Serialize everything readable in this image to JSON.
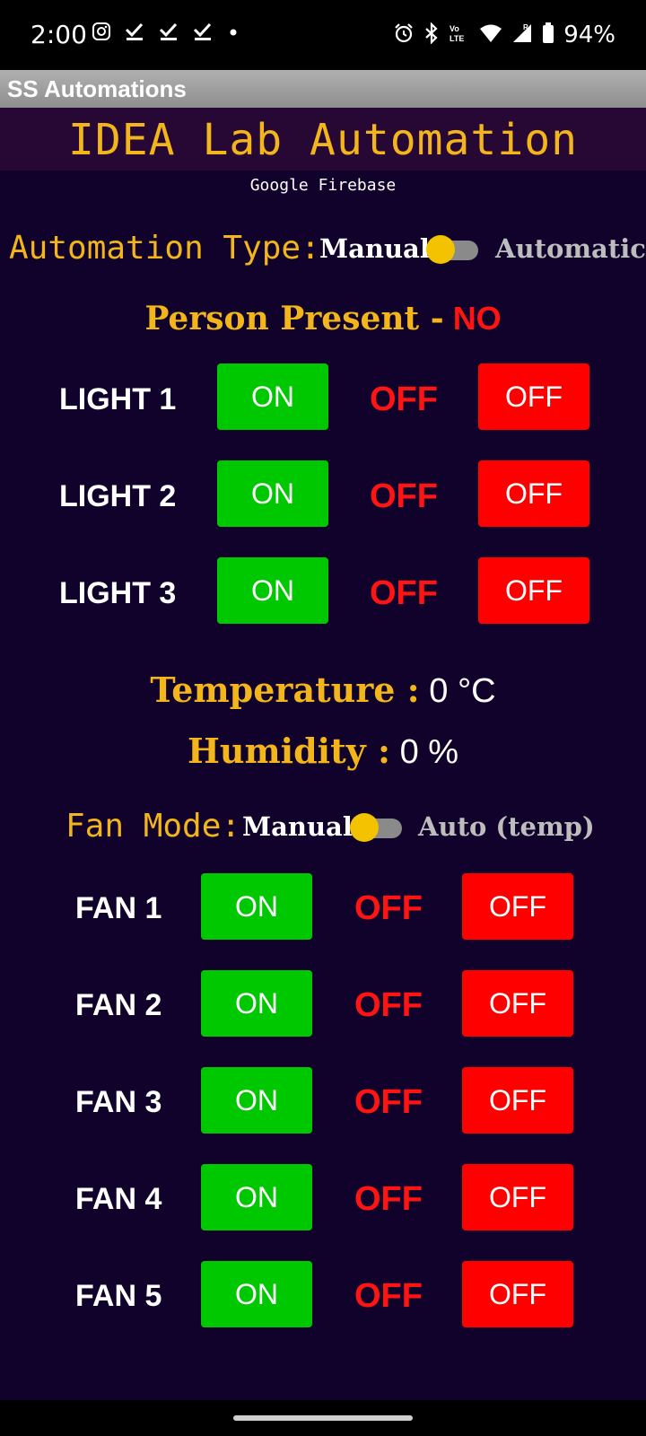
{
  "status_bar": {
    "time": "2:00",
    "left_icons": [
      "instagram-icon",
      "check-icon",
      "check-icon",
      "check-icon",
      "dot-icon"
    ],
    "right_icons": [
      "alarm-icon",
      "bluetooth-icon",
      "volte-icon",
      "wifi-icon",
      "signal-icon",
      "battery-icon"
    ],
    "battery": "94%"
  },
  "app_bar": {
    "title": "SS Automations"
  },
  "header": {
    "title": "IDEA Lab Automation",
    "subtitle": "Google Firebase"
  },
  "automation": {
    "label": "Automation Type:",
    "manual_label": "Manual",
    "auto_label": "Automatic"
  },
  "presence": {
    "label": "Person Present -",
    "value": "NO"
  },
  "lights": [
    {
      "label": "LIGHT 1",
      "on_label": "ON",
      "state": "OFF",
      "off_label": "OFF"
    },
    {
      "label": "LIGHT 2",
      "on_label": "ON",
      "state": "OFF",
      "off_label": "OFF"
    },
    {
      "label": "LIGHT 3",
      "on_label": "ON",
      "state": "OFF",
      "off_label": "OFF"
    }
  ],
  "sensors": {
    "temperature_label": "Temperature :",
    "temperature_value": "0 °C",
    "humidity_label": "Humidity :",
    "humidity_value": "0 %"
  },
  "fan_mode": {
    "label": "Fan Mode:",
    "manual_label": "Manual",
    "auto_label": "Auto (temp)"
  },
  "fans": [
    {
      "label": "FAN 1",
      "on_label": "ON",
      "state": "OFF",
      "off_label": "OFF"
    },
    {
      "label": "FAN 2",
      "on_label": "ON",
      "state": "OFF",
      "off_label": "OFF"
    },
    {
      "label": "FAN 3",
      "on_label": "ON",
      "state": "OFF",
      "off_label": "OFF"
    },
    {
      "label": "FAN 4",
      "on_label": "ON",
      "state": "OFF",
      "off_label": "OFF"
    },
    {
      "label": "FAN 5",
      "on_label": "ON",
      "state": "OFF",
      "off_label": "OFF"
    }
  ],
  "colors": {
    "background": "#10022b",
    "accent_gold": "#f2b51b",
    "on_green": "#00c800",
    "off_red": "#ff0000",
    "toggle_thumb": "#f3c200"
  }
}
